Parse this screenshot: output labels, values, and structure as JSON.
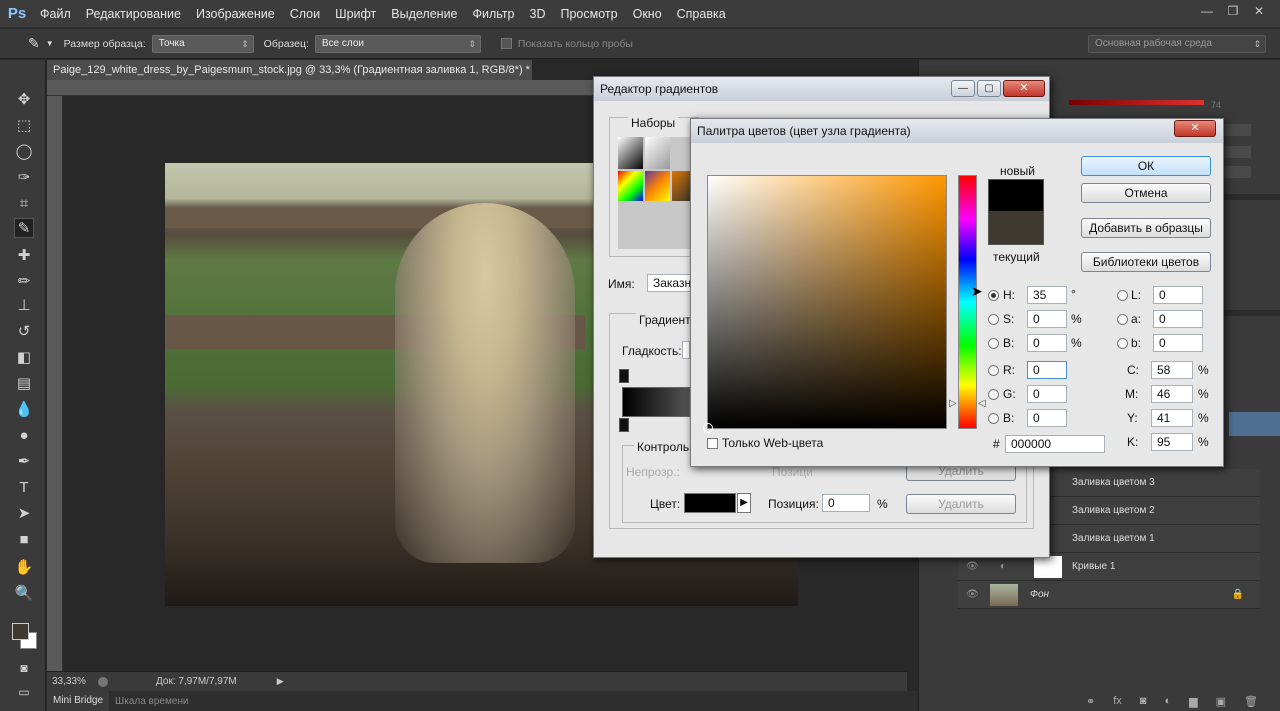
{
  "app": {
    "logo": "Ps"
  },
  "menu": [
    "Файл",
    "Редактирование",
    "Изображение",
    "Слои",
    "Шрифт",
    "Выделение",
    "Фильтр",
    "3D",
    "Просмотр",
    "Окно",
    "Справка"
  ],
  "options": {
    "sample_size_label": "Размер образца:",
    "sample_size_value": "Точка",
    "sample_label": "Образец:",
    "sample_value": "Все слои",
    "show_ring_label": "Показать кольцо пробы",
    "workspace": "Основная рабочая среда"
  },
  "document": {
    "tab_title": "Paige_129_white_dress_by_Paigesmum_stock.jpg @ 33,3% (Градиентная заливка 1, RGB/8*) *",
    "zoom": "33,33%",
    "doc_info": "Док: 7,97M/7,97M"
  },
  "bottom_tabs": [
    "Mini Bridge",
    "Шкала времени"
  ],
  "gradient_editor": {
    "title": "Редактор градиентов",
    "presets_label": "Наборы",
    "name_label": "Имя:",
    "name_value": "Заказная",
    "gradient_label": "Градиент",
    "smoothness_label": "Гладкость:",
    "stops_label": "Контрольные точки",
    "opacity_label": "Непрозр.:",
    "position_label_top": "Позиция:",
    "delete_label_top": "Удалить",
    "color_label": "Цвет:",
    "position_label": "Позиция:",
    "position_value": "0",
    "percent": "%",
    "delete_label": "Удалить"
  },
  "color_picker": {
    "title": "Палитра цветов (цвет узла градиента)",
    "new_label": "новый",
    "current_label": "текущий",
    "new_color": "#000000",
    "current_color": "#3f3a2f",
    "ok": "ОК",
    "cancel": "Отмена",
    "add_swatches": "Добавить в образцы",
    "color_libraries": "Библиотеки цветов",
    "hue_base": "#ff9600",
    "h_label": "H:",
    "h_value": "35",
    "h_unit": "°",
    "s_label": "S:",
    "s_value": "0",
    "s_unit": "%",
    "b_label": "B:",
    "b_value": "0",
    "b_unit": "%",
    "r_label": "R:",
    "r_value": "0",
    "g_label": "G:",
    "g_value": "0",
    "bb_label": "B:",
    "bb_value": "0",
    "l_label": "L:",
    "l_value": "0",
    "a_label": "a:",
    "a_value": "0",
    "b2_label": "b:",
    "b2_value": "0",
    "c_label": "C:",
    "c_value": "58",
    "m_label": "M:",
    "m_value": "46",
    "y_label": "Y:",
    "y_value": "41",
    "k_label": "K:",
    "k_value": "95",
    "cmyk_unit": "%",
    "hex_label": "#",
    "hex_value": "000000",
    "web_only_label": "Только Web-цвета"
  },
  "layers": {
    "items": [
      {
        "name": "Заливка цветом 3"
      },
      {
        "name": "Заливка цветом 2"
      },
      {
        "name": "Заливка цветом 1"
      },
      {
        "name": "Кривые 1"
      },
      {
        "name": "Фон"
      }
    ],
    "opacity_value": "74"
  }
}
